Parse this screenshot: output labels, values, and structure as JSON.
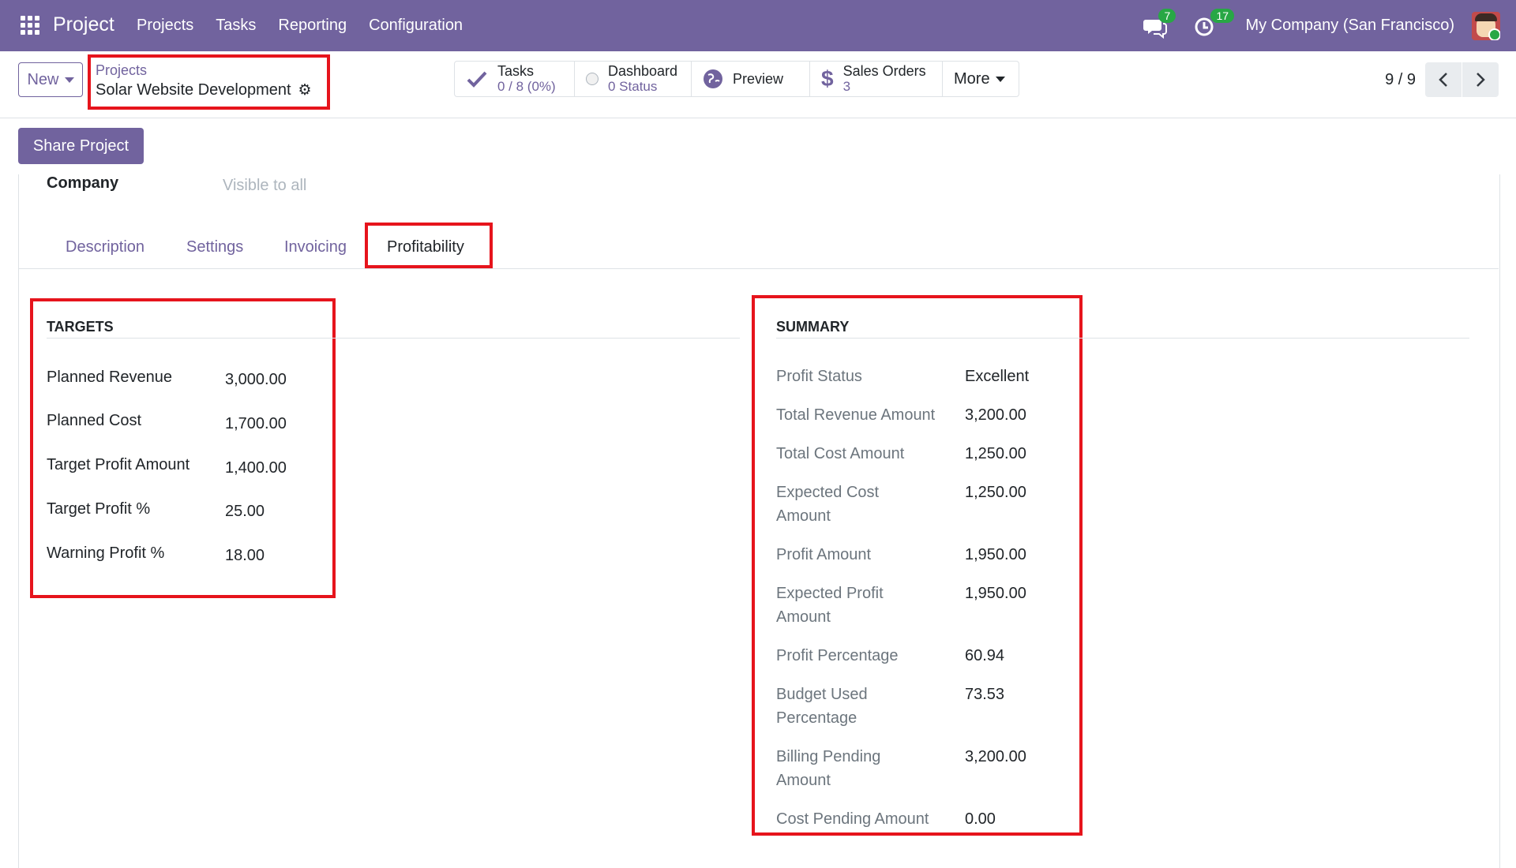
{
  "navbar": {
    "brand": "Project",
    "menu": [
      "Projects",
      "Tasks",
      "Reporting",
      "Configuration"
    ],
    "messages_count": "7",
    "activities_count": "17",
    "company": "My Company (San Francisco)"
  },
  "control": {
    "new_label": "New",
    "breadcrumb_parent": "Projects",
    "breadcrumb_current": "Solar Website Development",
    "stats": [
      {
        "icon": "check-icon",
        "title": "Tasks",
        "sub": "0 / 8 (0%)"
      },
      {
        "icon": "status-circle-icon",
        "title": "Dashboard",
        "sub": "0 Status"
      },
      {
        "icon": "globe-icon",
        "title": "Preview",
        "sub": ""
      },
      {
        "icon": "dollar-icon",
        "title": "Sales Orders",
        "sub": "3"
      },
      {
        "icon": "caret-icon",
        "title": "More",
        "sub": ""
      }
    ],
    "pager": "9 / 9"
  },
  "form": {
    "share_label": "Share Project",
    "company_label": "Company",
    "company_placeholder": "Visible to all",
    "tabs": [
      "Description",
      "Settings",
      "Invoicing",
      "Profitability"
    ],
    "active_tab": "Profitability"
  },
  "targets": {
    "title": "TARGETS",
    "rows": [
      {
        "label": "Planned Revenue",
        "value": "3,000.00"
      },
      {
        "label": "Planned Cost",
        "value": "1,700.00"
      },
      {
        "label": "Target Profit Amount",
        "value": "1,400.00"
      },
      {
        "label": "Target Profit %",
        "value": "25.00"
      },
      {
        "label": "Warning Profit %",
        "value": "18.00"
      }
    ]
  },
  "summary": {
    "title": "SUMMARY",
    "rows": [
      {
        "label": "Profit Status",
        "value": "Excellent"
      },
      {
        "label": "Total Revenue Amount",
        "value": "3,200.00"
      },
      {
        "label": "Total Cost Amount",
        "value": "1,250.00"
      },
      {
        "label": "Expected Cost Amount",
        "value": "1,250.00"
      },
      {
        "label": "Profit Amount",
        "value": "1,950.00"
      },
      {
        "label": "Expected Profit Amount",
        "value": "1,950.00"
      },
      {
        "label": "Profit Percentage",
        "value": "60.94"
      },
      {
        "label": "Budget Used Percentage",
        "value": "73.53"
      },
      {
        "label": "Billing Pending Amount",
        "value": "3,200.00"
      },
      {
        "label": "Cost Pending Amount",
        "value": "0.00"
      }
    ]
  },
  "colors": {
    "brand": "#71639e",
    "highlight": "#e6141c",
    "badge": "#28a745"
  }
}
